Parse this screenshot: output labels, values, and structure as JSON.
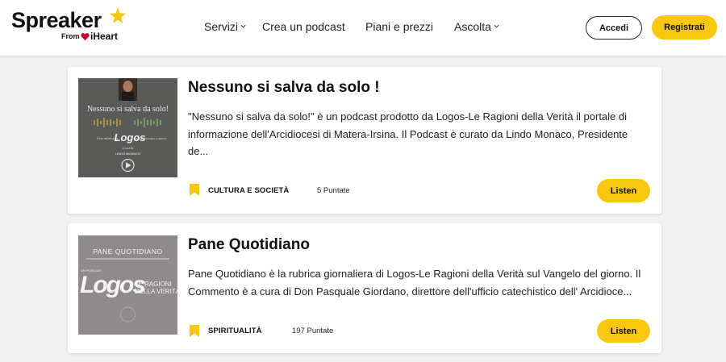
{
  "header": {
    "logo": {
      "word": "Spreaker",
      "from": "From",
      "iheart": "iHeart"
    },
    "nav": [
      {
        "label": "Servizi",
        "has_dropdown": true
      },
      {
        "label": "Crea un podcast",
        "has_dropdown": false
      },
      {
        "label": "Piani e prezzi",
        "has_dropdown": false
      },
      {
        "label": "Ascolta",
        "has_dropdown": true
      }
    ],
    "login_label": "Accedi",
    "signup_label": "Registrati"
  },
  "podcasts": [
    {
      "title": "Nessuno si salva da solo !",
      "description": "\"Nessuno si salva da solo!\" è un podcast prodotto da Logos-Le Ragioni della Verità il portale di informazione dell'Arcidiocesi di Matera-Irsina. Il Podcast è curato da Lindo Monaco, Presidente de...",
      "category": "CULTURA E SOCIETÀ",
      "episodes": "5 Puntate",
      "listen_label": "Listen",
      "cover": {
        "title": "Nessuno si salva da solo!",
        "line1": "Una rubrica di",
        "brand": "Logos",
        "brand_sub": "LE RAGIONI DELLA VERITÀ",
        "line2": "a cura di",
        "author": "LINDO MONACO"
      }
    },
    {
      "title": "Pane Quotidiano",
      "description": "Pane Quotidiano è la rubrica giornaliera di Logos-Le Ragioni della Verità sul Vangelo del giorno. Il Commento è a cura di Don Pasquale Giordano, direttore dell'ufficio catechistico dell' Arcidioce...",
      "category": "SPIRITUALITÀ",
      "episodes": "197 Puntate",
      "listen_label": "Listen",
      "cover": {
        "title": "PANE QUOTIDIANO",
        "tag": "UN PODCAST",
        "brand": "Logos",
        "brand_sub1": "LE RAGIONI",
        "brand_sub2": "DELLA VERITÀ"
      }
    }
  ],
  "colors": {
    "accent": "#f9c80e",
    "background": "#f2f2f2",
    "cover1_bg": "#5a5a58",
    "cover2_bg": "#8f8a8c"
  },
  "icons": {
    "logo_star": "star-icon",
    "iheart_logo": "heart-icon",
    "nav_dropdown": "chevron-down-icon",
    "category": "bookmark-icon",
    "cover_play": "play-icon"
  }
}
